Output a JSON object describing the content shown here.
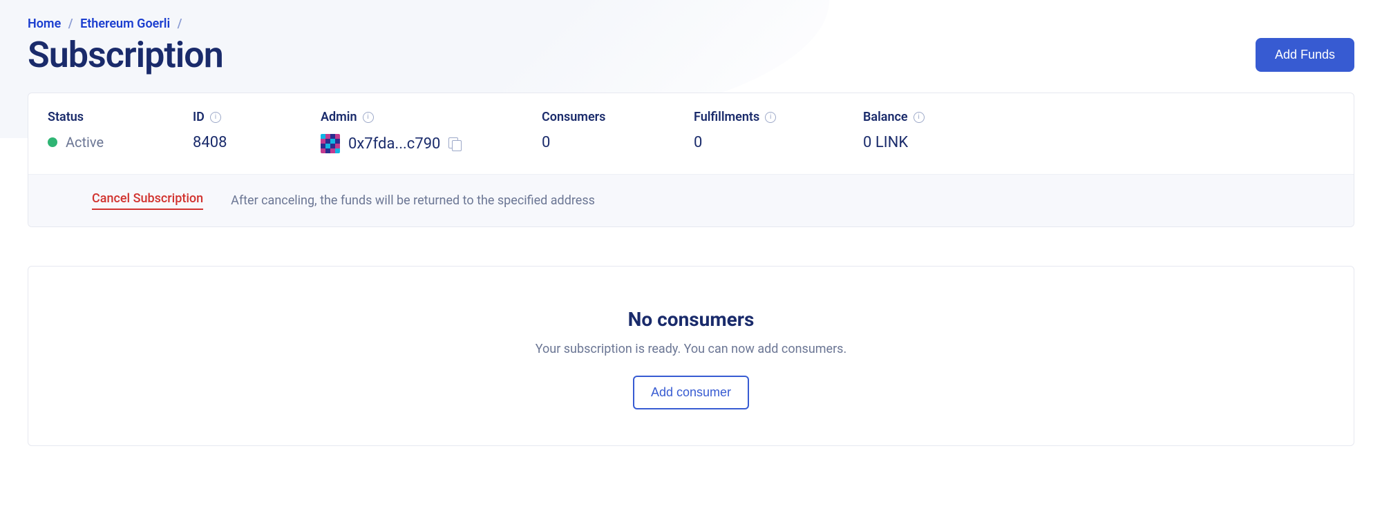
{
  "breadcrumb": {
    "home": "Home",
    "network": "Ethereum Goerli"
  },
  "page": {
    "title": "Subscription"
  },
  "actions": {
    "add_funds": "Add Funds",
    "add_consumer": "Add consumer"
  },
  "info": {
    "status": {
      "label": "Status",
      "value": "Active"
    },
    "id": {
      "label": "ID",
      "value": "8408"
    },
    "admin": {
      "label": "Admin",
      "value": "0x7fda...c790"
    },
    "consumers": {
      "label": "Consumers",
      "value": "0"
    },
    "fulfillments": {
      "label": "Fulfillments",
      "value": "0"
    },
    "balance": {
      "label": "Balance",
      "value": "0 LINK"
    }
  },
  "cancel": {
    "link": "Cancel Subscription",
    "description": "After canceling, the funds will be returned to the specified address"
  },
  "consumers_empty": {
    "title": "No consumers",
    "description": "Your subscription is ready. You can now add consumers."
  }
}
